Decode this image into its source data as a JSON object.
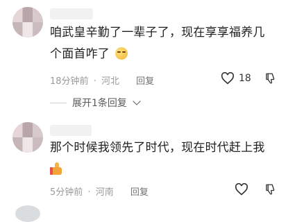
{
  "comments": [
    {
      "text_line1": "咱武皇辛勤了一辈子了，现在享享福养几",
      "text_line2": "个面首咋了",
      "time": "18分钟前",
      "location": "河北",
      "reply_label": "回复",
      "like_count": "18",
      "expand_label": "展开1条回复"
    },
    {
      "text_line1": "那个时候我领先了时代，现在时代赶上我",
      "time": "5分钟前",
      "location": "河南",
      "reply_label": "回复",
      "like_count": ""
    }
  ],
  "meta_separator": "·",
  "icons": {
    "like": "heart-icon",
    "dislike": "thumbs-down-icon",
    "emoji_1": "grinning-sweat-emoji-icon",
    "emoji_2": "thumbs-up-emoji-icon",
    "expand": "chevron-down-icon"
  },
  "colors": {
    "text": "#1f1f1f",
    "meta": "#9a9a9a",
    "background": "#ffffff"
  }
}
